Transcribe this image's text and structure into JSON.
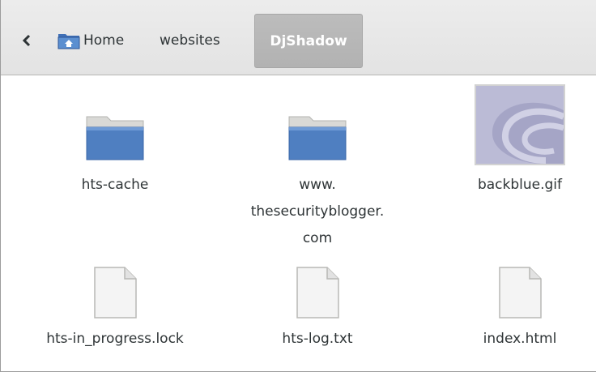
{
  "breadcrumb": {
    "back_icon": "chevron-left-icon",
    "home_icon": "home-folder-icon",
    "home_label": "Home",
    "websites_label": "websites",
    "current_label": "DjShadow"
  },
  "items": [
    {
      "name": "hts-cache",
      "icon": "folder-icon"
    },
    {
      "name_lines": [
        "www.",
        "thesecurityblogger.",
        "com"
      ],
      "icon": "folder-icon"
    },
    {
      "name": "backblue.gif",
      "icon": "image-thumbnail-icon"
    },
    {
      "name": "hts-in_progress.lock",
      "icon": "text-file-icon"
    },
    {
      "name": "hts-log.txt",
      "icon": "text-file-icon"
    },
    {
      "name": "index.html",
      "icon": "text-file-icon"
    }
  ]
}
